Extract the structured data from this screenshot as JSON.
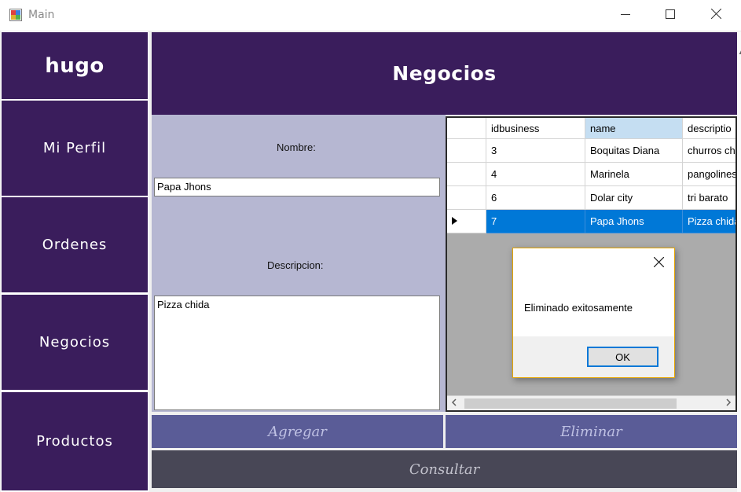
{
  "window": {
    "title": "Main"
  },
  "sidebar": {
    "user": "hugo",
    "items": [
      {
        "label": "Mi Perfil"
      },
      {
        "label": "Ordenes"
      },
      {
        "label": "Negocios"
      },
      {
        "label": "Productos"
      }
    ]
  },
  "header": {
    "title": "Negocios"
  },
  "form": {
    "nombre_label": "Nombre:",
    "nombre_value": "Papa Jhons",
    "descripcion_label": "Descripcion:",
    "descripcion_value": "Pizza chida"
  },
  "grid": {
    "columns": [
      "idbusiness",
      "name",
      "descriptio"
    ],
    "rows": [
      {
        "id": "3",
        "name": "Boquitas Diana",
        "description": "churros ch"
      },
      {
        "id": "4",
        "name": "Marinela",
        "description": "pangolines"
      },
      {
        "id": "6",
        "name": "Dolar city",
        "description": "tri barato"
      },
      {
        "id": "7",
        "name": "Papa Jhons",
        "description": "Pizza chida"
      }
    ],
    "selected_row_index": 3
  },
  "dialog": {
    "message": "Eliminado exitosamente",
    "ok_label": "OK"
  },
  "buttons": {
    "agregar": "Agregar",
    "eliminar": "Eliminar",
    "consultar": "Consultar"
  },
  "colors": {
    "purple_dark": "#3a1d5c",
    "form_bg": "#b6b7d2",
    "button_purple": "#5a5c97",
    "button_dark": "#484756",
    "selection_blue": "#0078d7"
  }
}
